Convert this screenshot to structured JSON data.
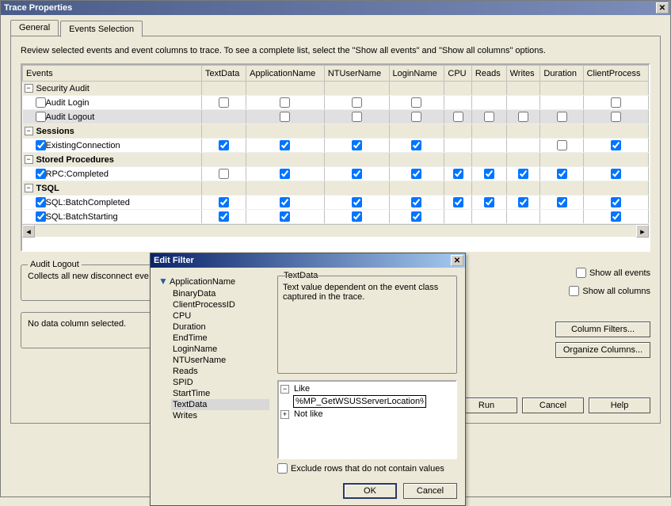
{
  "window": {
    "title": "Trace Properties"
  },
  "tabs": {
    "general": "General",
    "events_selection": "Events Selection"
  },
  "instructions": "Review selected events and event columns to trace. To see a complete list, select the \"Show all events\" and \"Show all columns\" options.",
  "grid": {
    "headers": [
      "Events",
      "TextData",
      "ApplicationName",
      "NTUserName",
      "LoginName",
      "CPU",
      "Reads",
      "Writes",
      "Duration",
      "ClientProcess"
    ],
    "rows": [
      {
        "type": "group",
        "label": "Security Audit",
        "expanded": true
      },
      {
        "type": "event",
        "label": "Audit Login",
        "indent": true,
        "enabled": false,
        "cells": [
          false,
          false,
          false,
          false,
          null,
          null,
          null,
          null,
          false
        ]
      },
      {
        "type": "event",
        "label": "Audit Logout",
        "indent": true,
        "enabled": false,
        "selected": true,
        "cells": [
          null,
          false,
          false,
          false,
          false,
          false,
          false,
          false,
          false
        ]
      },
      {
        "type": "group",
        "label": "Sessions",
        "expanded": true,
        "bold": true
      },
      {
        "type": "event",
        "label": "ExistingConnection",
        "indent": true,
        "enabled": true,
        "cells": [
          true,
          true,
          true,
          true,
          null,
          null,
          null,
          false,
          true
        ]
      },
      {
        "type": "group",
        "label": "Stored Procedures",
        "expanded": true,
        "bold": true
      },
      {
        "type": "event",
        "label": "RPC:Completed",
        "indent": true,
        "enabled": true,
        "cells": [
          false,
          true,
          true,
          true,
          true,
          true,
          true,
          true,
          true
        ]
      },
      {
        "type": "group",
        "label": "TSQL",
        "expanded": true,
        "bold": true
      },
      {
        "type": "event",
        "label": "SQL:BatchCompleted",
        "indent": true,
        "enabled": true,
        "cells": [
          true,
          true,
          true,
          true,
          true,
          true,
          true,
          true,
          true
        ]
      },
      {
        "type": "event",
        "label": "SQL:BatchStarting",
        "indent": true,
        "enabled": true,
        "cells": [
          true,
          true,
          true,
          true,
          null,
          null,
          null,
          null,
          true
        ]
      }
    ]
  },
  "desc_panel": {
    "title": "Audit Logout",
    "text": "Collects all new disconnect eve"
  },
  "col_desc_panel": {
    "text": "No data column selected."
  },
  "options": {
    "show_all_events": "Show all events",
    "show_all_columns": "Show all columns",
    "column_filters_btn": "Column Filters...",
    "organize_columns_btn": "Organize Columns..."
  },
  "buttons": {
    "run": "Run",
    "cancel": "Cancel",
    "help": "Help"
  },
  "modal": {
    "title": "Edit Filter",
    "columns": [
      "ApplicationName",
      "BinaryData",
      "ClientProcessID",
      "CPU",
      "Duration",
      "EndTime",
      "LoginName",
      "NTUserName",
      "Reads",
      "SPID",
      "StartTime",
      "TextData",
      "Writes"
    ],
    "selected_column": "TextData",
    "detail_title": "TextData",
    "detail_text": "Text value dependent on the event class captured in the trace.",
    "tree": {
      "like_label": "Like",
      "like_value": "%MP_GetWSUSServerLocation%",
      "notlike_label": "Not like"
    },
    "exclude_label": "Exclude rows that do not contain values",
    "ok": "OK",
    "cancel": "Cancel"
  }
}
